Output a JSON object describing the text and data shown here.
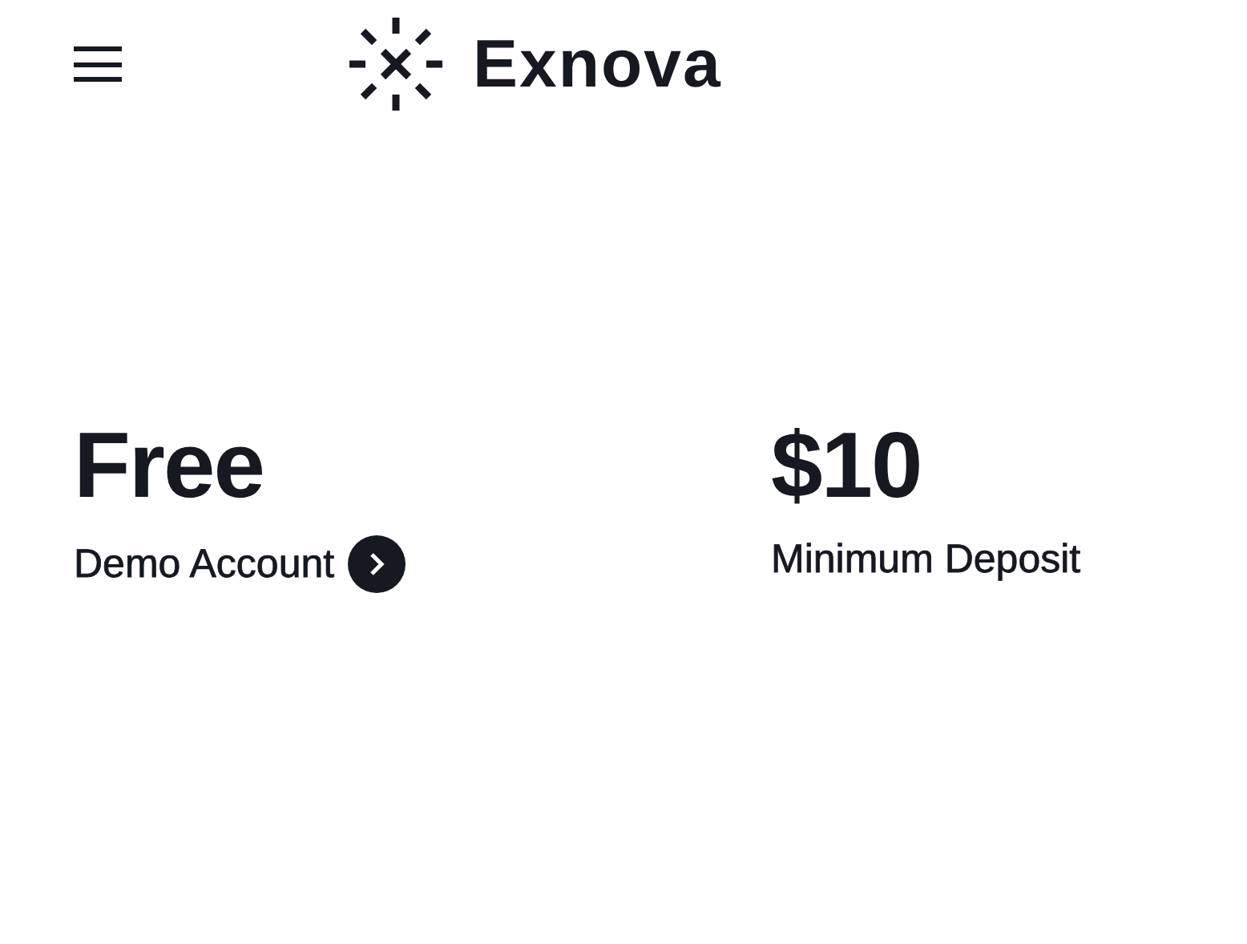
{
  "header": {
    "brand": "Exnova"
  },
  "stats": [
    {
      "value": "Free",
      "label": "Demo Account",
      "link": true
    },
    {
      "value": "$10",
      "label": "Minimum Deposit",
      "link": false
    }
  ]
}
